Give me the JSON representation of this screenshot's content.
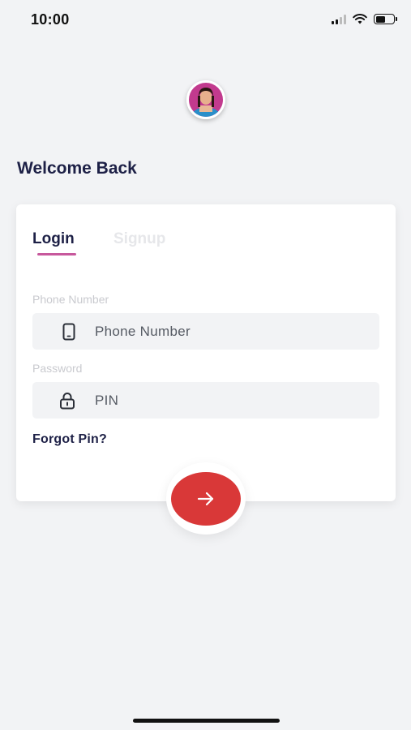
{
  "status_bar": {
    "time": "10:00",
    "icons": [
      "signal-icon",
      "wifi-icon",
      "battery-icon"
    ]
  },
  "header": {
    "welcome": "Welcome Back"
  },
  "tabs": {
    "login": "Login",
    "signup": "Signup",
    "active": "Login"
  },
  "form": {
    "phone": {
      "label": "Phone Number",
      "placeholder": "Phone Number",
      "icon": "phone-icon"
    },
    "password": {
      "label": "Password",
      "placeholder": "PIN",
      "icon": "lock-icon"
    },
    "forgot_link": "Forgot Pin?"
  },
  "submit": {
    "icon": "arrow-right-icon"
  },
  "colors": {
    "background": "#f2f3f5",
    "title": "#1d2046",
    "accent": "#c7589c",
    "submit": "#d93838",
    "label": "#c9cacf"
  }
}
